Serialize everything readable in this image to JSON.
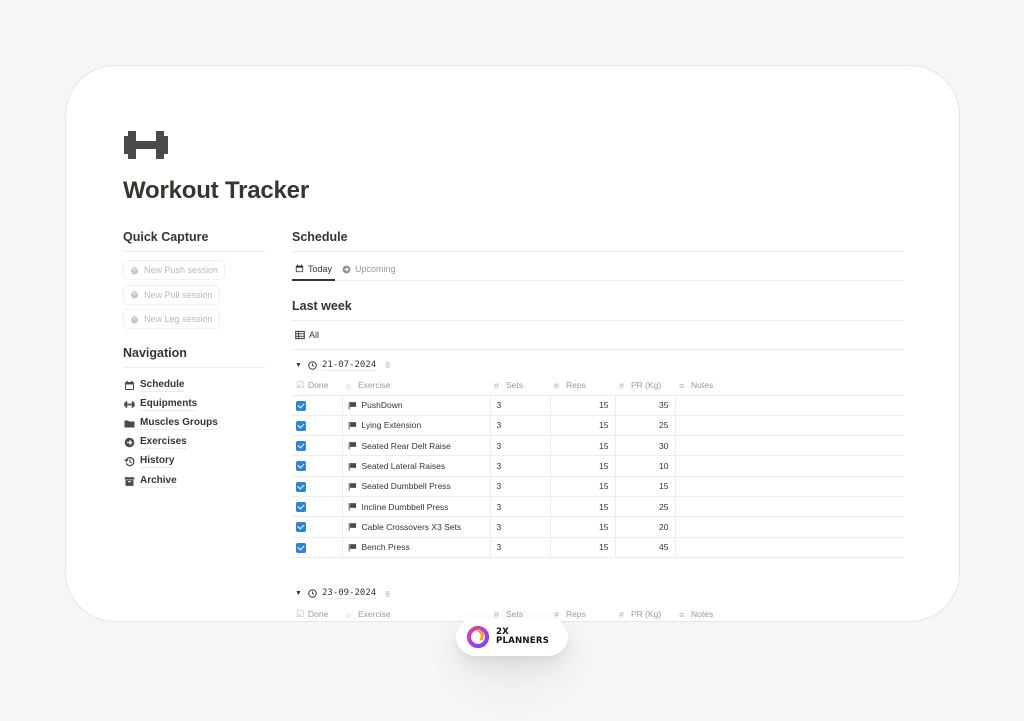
{
  "page": {
    "icon": "dumbbell-icon",
    "title": "Workout Tracker"
  },
  "quick_capture": {
    "heading": "Quick Capture",
    "buttons": [
      {
        "label": "New Push session",
        "icon": "timer-icon"
      },
      {
        "label": "New Pull session",
        "icon": "timer-icon"
      },
      {
        "label": "New Leg session",
        "icon": "timer-icon"
      }
    ]
  },
  "navigation": {
    "heading": "Navigation",
    "items": [
      {
        "label": "Schedule",
        "icon": "calendar-icon"
      },
      {
        "label": "Equipments",
        "icon": "dumbbell-icon"
      },
      {
        "label": "Muscles Groups",
        "icon": "folder-icon"
      },
      {
        "label": "Exercises",
        "icon": "arrow-circle-icon"
      },
      {
        "label": "History",
        "icon": "history-icon"
      },
      {
        "label": "Archive",
        "icon": "archive-icon"
      }
    ]
  },
  "schedule": {
    "heading": "Schedule",
    "tabs": [
      {
        "label": "Today",
        "icon": "calendar-icon",
        "active": true
      },
      {
        "label": "Upcoming",
        "icon": "arrow-circle-icon",
        "active": false
      }
    ]
  },
  "last_week": {
    "heading": "Last week",
    "view": {
      "label": "All",
      "icon": "table-icon"
    },
    "columns": [
      {
        "label": "Done",
        "icon": "checkbox-icon"
      },
      {
        "label": "Exercise",
        "icon": "circle-icon"
      },
      {
        "label": "Sets",
        "icon": "hash-icon"
      },
      {
        "label": "Reps",
        "icon": "hash-icon"
      },
      {
        "label": "PR (Kg)",
        "icon": "hash-icon"
      },
      {
        "label": "Notes",
        "icon": "text-lines-icon"
      }
    ],
    "groups": [
      {
        "date": "21-07-2024",
        "count": "8",
        "expanded": true,
        "rows": [
          {
            "done": true,
            "exercise": "PushDown",
            "sets": "3",
            "reps": "15",
            "pr": "35",
            "notes": ""
          },
          {
            "done": true,
            "exercise": "Lying Extension",
            "sets": "3",
            "reps": "15",
            "pr": "25",
            "notes": ""
          },
          {
            "done": true,
            "exercise": "Seated Rear Delt Raise",
            "sets": "3",
            "reps": "15",
            "pr": "30",
            "notes": ""
          },
          {
            "done": true,
            "exercise": "Seated Lateral Raises",
            "sets": "3",
            "reps": "15",
            "pr": "10",
            "notes": ""
          },
          {
            "done": true,
            "exercise": "Seated Dumbbell Press",
            "sets": "3",
            "reps": "15",
            "pr": "15",
            "notes": ""
          },
          {
            "done": true,
            "exercise": "Incline Dumbbell Press",
            "sets": "3",
            "reps": "15",
            "pr": "25",
            "notes": ""
          },
          {
            "done": true,
            "exercise": "Cable Crossovers X3 Sets",
            "sets": "3",
            "reps": "15",
            "pr": "20",
            "notes": ""
          },
          {
            "done": true,
            "exercise": "Bench Press",
            "sets": "3",
            "reps": "15",
            "pr": "45",
            "notes": ""
          }
        ]
      },
      {
        "date": "23-09-2024",
        "count": "8",
        "expanded": true,
        "rows": []
      }
    ]
  },
  "badge": {
    "line1": "2X",
    "line2": "PLANNERS",
    "logo": "2x-planners-logo-icon"
  },
  "colors": {
    "checkbox": "#2f83d6",
    "text": "#37352f",
    "muted": "#9b9a97",
    "background": "#f6f6f6",
    "logo_gradient": [
      "#f7a21b",
      "#e0439a",
      "#8a3ff0"
    ]
  }
}
